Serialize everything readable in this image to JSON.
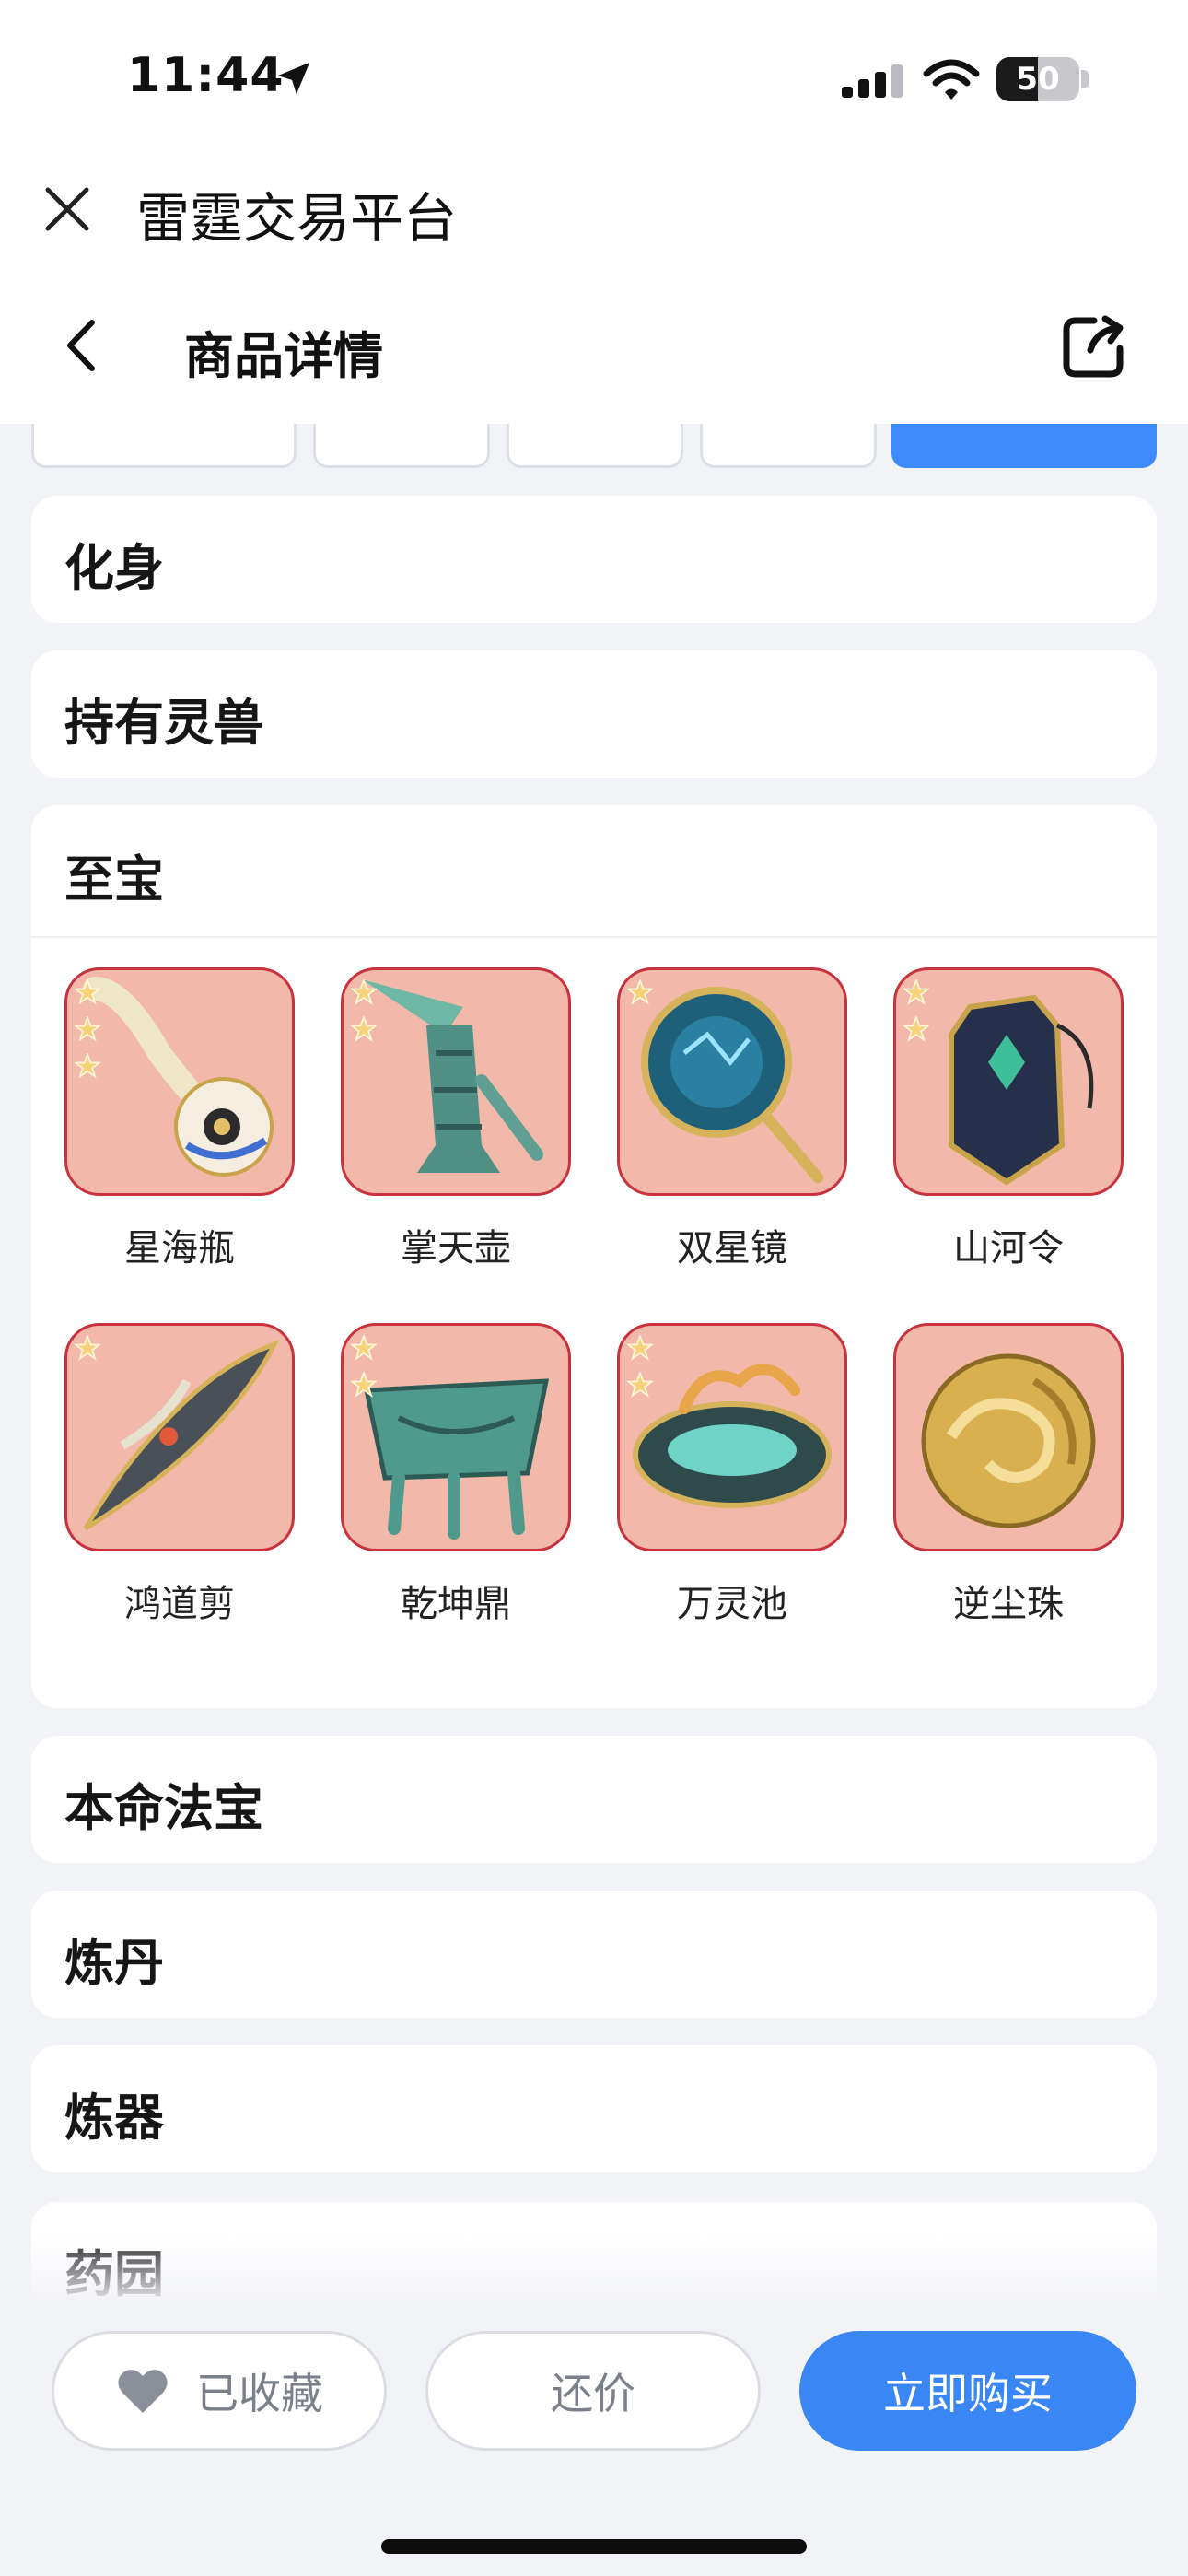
{
  "status_bar": {
    "time": "11:44",
    "battery_level": "50",
    "battery_fraction": 0.5,
    "icons": [
      "location-arrow-icon",
      "cellular-signal-icon",
      "wifi-icon",
      "battery-icon"
    ]
  },
  "app": {
    "title": "雷霆交易平台",
    "close_icon": "close-icon"
  },
  "nav": {
    "back_icon": "chevron-left-icon",
    "title": "商品详情",
    "share_icon": "share-external-icon"
  },
  "sections": {
    "avatar": "化身",
    "beasts": "持有灵兽",
    "treasures": "至宝",
    "natal_treasure": "本命法宝",
    "alchemy": "炼丹",
    "forging": "炼器",
    "herb_garden": "药园"
  },
  "treasures": [
    {
      "name": "星海瓶",
      "stars": 3
    },
    {
      "name": "掌天壶",
      "stars": 2
    },
    {
      "name": "双星镜",
      "stars": 1
    },
    {
      "name": "山河令",
      "stars": 2
    },
    {
      "name": "鸿道剪",
      "stars": 1
    },
    {
      "name": "乾坤鼎",
      "stars": 2
    },
    {
      "name": "万灵池",
      "stars": 2
    },
    {
      "name": "逆尘珠",
      "stars": 0
    }
  ],
  "actions": {
    "favorite": "已收藏",
    "counter_offer": "还价",
    "buy_now": "立即购买"
  },
  "colors": {
    "primary": "#3a86f5",
    "item_bg": "#f2b8aa",
    "item_border": "#c8323e",
    "star": "#f6d27a",
    "page_bg": "#f2f3f7"
  }
}
